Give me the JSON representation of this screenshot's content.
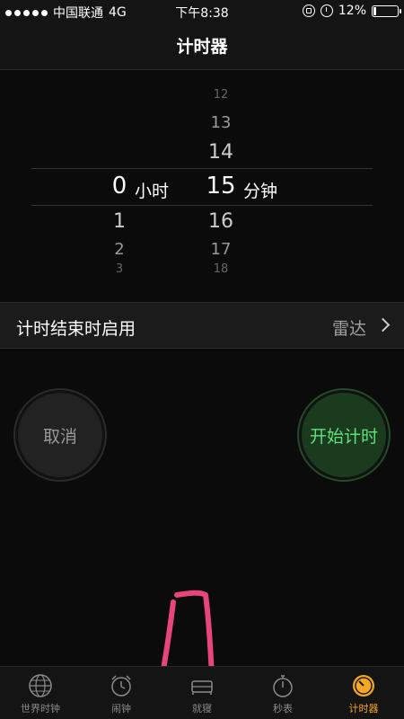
{
  "status_bar": {
    "carrier": "中国联通",
    "network": "4G",
    "time": "下午8:38",
    "battery": "12%"
  },
  "nav": {
    "title": "计时器"
  },
  "picker": {
    "hours": {
      "above": [
        "",
        "",
        ""
      ],
      "selected": "0",
      "below": [
        "1",
        "2",
        "3"
      ],
      "unit": "小时"
    },
    "minutes": {
      "above": [
        "12",
        "13",
        "14"
      ],
      "selected": "15",
      "below": [
        "16",
        "17",
        "18"
      ],
      "unit": "分钟"
    }
  },
  "setting": {
    "label": "计时结束时启用",
    "value": "雷达"
  },
  "buttons": {
    "cancel": "取消",
    "start": "开始计时"
  },
  "tabs": [
    {
      "label": "世界时钟",
      "icon": "globe-icon"
    },
    {
      "label": "闹钟",
      "icon": "alarm-clock-icon"
    },
    {
      "label": "就寝",
      "icon": "bed-icon"
    },
    {
      "label": "秒表",
      "icon": "stopwatch-icon"
    },
    {
      "label": "计时器",
      "icon": "timer-icon",
      "active": true
    }
  ],
  "colors": {
    "accent": "#f5a623",
    "start_green": "#5fe07a"
  }
}
